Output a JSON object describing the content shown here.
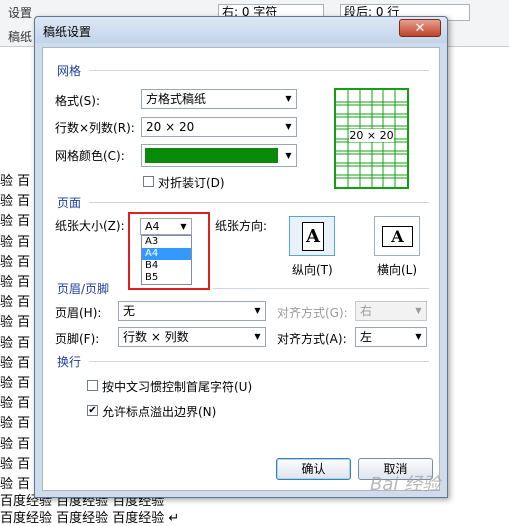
{
  "background_doc": {
    "ribbon_fragments": [
      "设置",
      "稿纸",
      "右: 0 字符",
      "段后: 0 行"
    ],
    "doc_left_chars": [
      "验 百",
      "验 百",
      "验 百",
      "验 百",
      "验 百",
      "验 百",
      "验 百",
      "验 百",
      "验 百",
      "验 百",
      "验 百",
      "验 百",
      "验 百",
      "验 百",
      "验 百",
      "验 百"
    ],
    "bottom_line_1": "百度经验 百度经验 百度经验",
    "bottom_line_2": "百度经验  百度经验  百度经验 ↵"
  },
  "dialog": {
    "title": "稿纸设置",
    "close_symbol": "✕",
    "grid_section": {
      "title": "网格",
      "format_label": "格式(S):",
      "format_value": "方格式稿纸",
      "rows_cols_label": "行数×列数(R):",
      "rows_cols_value": "20 × 20",
      "grid_color_label": "网格颜色(C):",
      "grid_color": "#0a8a0a",
      "fold_binding_label": "对折装订(D)",
      "preview_text": "20 × 20",
      "preview_color": "#13a013"
    },
    "page_section": {
      "title": "页面",
      "paper_size_label": "纸张大小(Z):",
      "paper_size_value": "A4",
      "paper_size_options": [
        "A3",
        "A4",
        "B4",
        "B5"
      ],
      "highlighted_option": "A4",
      "orientation_label": "纸张方向:",
      "portrait_label": "纵向(T)",
      "landscape_label": "横向(L)",
      "icon_letter": "A"
    },
    "header_footer_section": {
      "title": "页眉/页脚",
      "header_label": "页眉(H):",
      "header_value": "无",
      "header_align_label": "对齐方式(G):",
      "header_align_value": "右",
      "footer_label": "页脚(F):",
      "footer_value": "行数 × 列数",
      "footer_align_label": "对齐方式(A):",
      "footer_align_value": "左"
    },
    "wrap_section": {
      "title": "换行",
      "option1_label": "按中文习惯控制首尾字符(U)",
      "option1_checked": false,
      "option2_label": "允许标点溢出边界(N)",
      "option2_checked": true
    },
    "ok_label": "确认",
    "cancel_label": "取消"
  },
  "highlight_color": "#e02020",
  "watermark": "Bai 经验"
}
